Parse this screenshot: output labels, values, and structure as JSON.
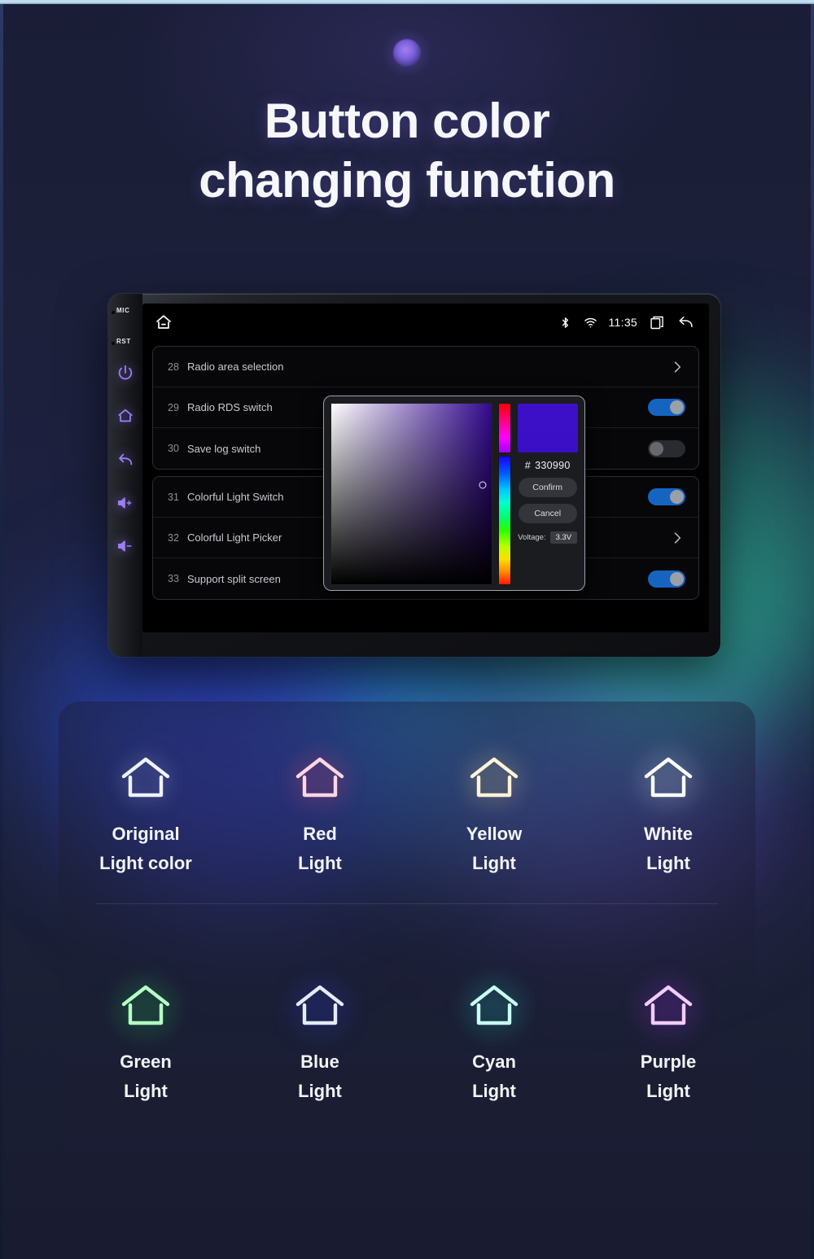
{
  "header": {
    "title_line1": "Button color",
    "title_line2": "changing function",
    "orb_icon": "glow-orb"
  },
  "device": {
    "bezel": {
      "mic_label": "MIC",
      "rst_label": "RST",
      "buttons": [
        {
          "name": "power-icon"
        },
        {
          "name": "home-icon"
        },
        {
          "name": "back-icon"
        },
        {
          "name": "volume-up-icon"
        },
        {
          "name": "volume-down-icon"
        }
      ],
      "accent_color": "#9b7ef0"
    },
    "statusbar": {
      "home_icon": "home-icon",
      "bluetooth_icon": "bluetooth-icon",
      "wifi_icon": "wifi-icon",
      "time": "11:35",
      "recents_icon": "recent-apps-icon",
      "back_icon": "back-arrow-icon"
    },
    "settings": {
      "group_a": [
        {
          "num": "28",
          "label": "Radio area selection",
          "control": "chevron"
        },
        {
          "num": "29",
          "label": "Radio RDS switch",
          "control": "toggle-on"
        },
        {
          "num": "30",
          "label": "Save log switch",
          "control": "toggle-off"
        }
      ],
      "group_b": [
        {
          "num": "31",
          "label": "Colorful Light Switch",
          "control": "toggle-on"
        },
        {
          "num": "32",
          "label": "Colorful Light Picker",
          "control": "chevron"
        },
        {
          "num": "33",
          "label": "Support split screen",
          "control": "toggle-on"
        }
      ]
    },
    "picker": {
      "hex_symbol": "#",
      "hex_value": "330990",
      "confirm_label": "Confirm",
      "cancel_label": "Cancel",
      "voltage_label": "Voltage:",
      "voltage_value": "3.3V",
      "selected_color": "#330990"
    }
  },
  "lights": [
    {
      "label_line1": "Original",
      "label_line2": "Light color",
      "icon": "house-icon",
      "color": "#eef2ff",
      "glow": "rgba(200,215,255,0.55)"
    },
    {
      "label_line1": "Red",
      "label_line2": "Light",
      "icon": "house-icon",
      "color": "#ffd6e2",
      "glow": "rgba(255,70,110,0.85)"
    },
    {
      "label_line1": "Yellow",
      "label_line2": "Light",
      "icon": "house-icon",
      "color": "#fff3d8",
      "glow": "rgba(255,215,130,0.80)"
    },
    {
      "label_line1": "White",
      "label_line2": "Light",
      "icon": "house-icon",
      "color": "#ffffff",
      "glow": "rgba(235,240,255,0.95)"
    },
    {
      "label_line1": "Green",
      "label_line2": "Light",
      "icon": "house-icon",
      "color": "#b6ffc4",
      "glow": "rgba(40,230,90,0.90)"
    },
    {
      "label_line1": "Blue",
      "label_line2": "Light",
      "icon": "house-icon",
      "color": "#e4ebff",
      "glow": "rgba(50,70,255,0.95)"
    },
    {
      "label_line1": "Cyan",
      "label_line2": "Light",
      "icon": "house-icon",
      "color": "#c9fff4",
      "glow": "rgba(30,225,210,0.90)"
    },
    {
      "label_line1": "Purple",
      "label_line2": "Light",
      "icon": "house-icon",
      "color": "#f0ccff",
      "glow": "rgba(175,50,255,0.92)"
    }
  ]
}
